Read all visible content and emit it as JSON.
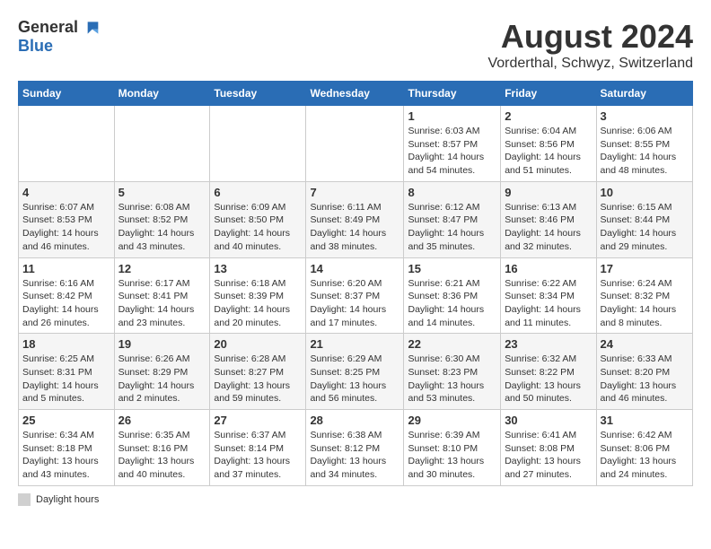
{
  "header": {
    "logo_general": "General",
    "logo_blue": "Blue",
    "title": "August 2024",
    "subtitle": "Vorderthal, Schwyz, Switzerland"
  },
  "days_of_week": [
    "Sunday",
    "Monday",
    "Tuesday",
    "Wednesday",
    "Thursday",
    "Friday",
    "Saturday"
  ],
  "weeks": [
    [
      {
        "day": "",
        "info": ""
      },
      {
        "day": "",
        "info": ""
      },
      {
        "day": "",
        "info": ""
      },
      {
        "day": "",
        "info": ""
      },
      {
        "day": "1",
        "info": "Sunrise: 6:03 AM\nSunset: 8:57 PM\nDaylight: 14 hours\nand 54 minutes."
      },
      {
        "day": "2",
        "info": "Sunrise: 6:04 AM\nSunset: 8:56 PM\nDaylight: 14 hours\nand 51 minutes."
      },
      {
        "day": "3",
        "info": "Sunrise: 6:06 AM\nSunset: 8:55 PM\nDaylight: 14 hours\nand 48 minutes."
      }
    ],
    [
      {
        "day": "4",
        "info": "Sunrise: 6:07 AM\nSunset: 8:53 PM\nDaylight: 14 hours\nand 46 minutes."
      },
      {
        "day": "5",
        "info": "Sunrise: 6:08 AM\nSunset: 8:52 PM\nDaylight: 14 hours\nand 43 minutes."
      },
      {
        "day": "6",
        "info": "Sunrise: 6:09 AM\nSunset: 8:50 PM\nDaylight: 14 hours\nand 40 minutes."
      },
      {
        "day": "7",
        "info": "Sunrise: 6:11 AM\nSunset: 8:49 PM\nDaylight: 14 hours\nand 38 minutes."
      },
      {
        "day": "8",
        "info": "Sunrise: 6:12 AM\nSunset: 8:47 PM\nDaylight: 14 hours\nand 35 minutes."
      },
      {
        "day": "9",
        "info": "Sunrise: 6:13 AM\nSunset: 8:46 PM\nDaylight: 14 hours\nand 32 minutes."
      },
      {
        "day": "10",
        "info": "Sunrise: 6:15 AM\nSunset: 8:44 PM\nDaylight: 14 hours\nand 29 minutes."
      }
    ],
    [
      {
        "day": "11",
        "info": "Sunrise: 6:16 AM\nSunset: 8:42 PM\nDaylight: 14 hours\nand 26 minutes."
      },
      {
        "day": "12",
        "info": "Sunrise: 6:17 AM\nSunset: 8:41 PM\nDaylight: 14 hours\nand 23 minutes."
      },
      {
        "day": "13",
        "info": "Sunrise: 6:18 AM\nSunset: 8:39 PM\nDaylight: 14 hours\nand 20 minutes."
      },
      {
        "day": "14",
        "info": "Sunrise: 6:20 AM\nSunset: 8:37 PM\nDaylight: 14 hours\nand 17 minutes."
      },
      {
        "day": "15",
        "info": "Sunrise: 6:21 AM\nSunset: 8:36 PM\nDaylight: 14 hours\nand 14 minutes."
      },
      {
        "day": "16",
        "info": "Sunrise: 6:22 AM\nSunset: 8:34 PM\nDaylight: 14 hours\nand 11 minutes."
      },
      {
        "day": "17",
        "info": "Sunrise: 6:24 AM\nSunset: 8:32 PM\nDaylight: 14 hours\nand 8 minutes."
      }
    ],
    [
      {
        "day": "18",
        "info": "Sunrise: 6:25 AM\nSunset: 8:31 PM\nDaylight: 14 hours\nand 5 minutes."
      },
      {
        "day": "19",
        "info": "Sunrise: 6:26 AM\nSunset: 8:29 PM\nDaylight: 14 hours\nand 2 minutes."
      },
      {
        "day": "20",
        "info": "Sunrise: 6:28 AM\nSunset: 8:27 PM\nDaylight: 13 hours\nand 59 minutes."
      },
      {
        "day": "21",
        "info": "Sunrise: 6:29 AM\nSunset: 8:25 PM\nDaylight: 13 hours\nand 56 minutes."
      },
      {
        "day": "22",
        "info": "Sunrise: 6:30 AM\nSunset: 8:23 PM\nDaylight: 13 hours\nand 53 minutes."
      },
      {
        "day": "23",
        "info": "Sunrise: 6:32 AM\nSunset: 8:22 PM\nDaylight: 13 hours\nand 50 minutes."
      },
      {
        "day": "24",
        "info": "Sunrise: 6:33 AM\nSunset: 8:20 PM\nDaylight: 13 hours\nand 46 minutes."
      }
    ],
    [
      {
        "day": "25",
        "info": "Sunrise: 6:34 AM\nSunset: 8:18 PM\nDaylight: 13 hours\nand 43 minutes."
      },
      {
        "day": "26",
        "info": "Sunrise: 6:35 AM\nSunset: 8:16 PM\nDaylight: 13 hours\nand 40 minutes."
      },
      {
        "day": "27",
        "info": "Sunrise: 6:37 AM\nSunset: 8:14 PM\nDaylight: 13 hours\nand 37 minutes."
      },
      {
        "day": "28",
        "info": "Sunrise: 6:38 AM\nSunset: 8:12 PM\nDaylight: 13 hours\nand 34 minutes."
      },
      {
        "day": "29",
        "info": "Sunrise: 6:39 AM\nSunset: 8:10 PM\nDaylight: 13 hours\nand 30 minutes."
      },
      {
        "day": "30",
        "info": "Sunrise: 6:41 AM\nSunset: 8:08 PM\nDaylight: 13 hours\nand 27 minutes."
      },
      {
        "day": "31",
        "info": "Sunrise: 6:42 AM\nSunset: 8:06 PM\nDaylight: 13 hours\nand 24 minutes."
      }
    ]
  ],
  "footer": {
    "icon": "gray-box",
    "label": "Daylight hours"
  }
}
